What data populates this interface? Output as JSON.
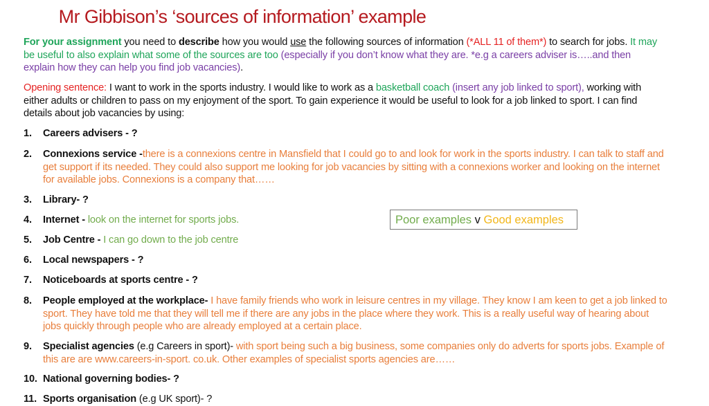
{
  "title": "Mr Gibbison’s ‘sources of information’ example",
  "intro": {
    "lead": "For your assignment",
    "t1": " you need to ",
    "describe": "describe",
    "t2": " how you would ",
    "use": "use",
    "t3": " the following sources of information ",
    "all11": "(*ALL 11 of them*)",
    "t4": " to search for jobs. ",
    "green_tip": "It may be useful to also explain what some of the sources are too",
    "purple_tip": " (especially if you don’t know what they are. *e.g a careers adviser is…..and then explain how they can help you find job vacancies)",
    "end": "."
  },
  "opening": {
    "label": "Opening sentence:",
    "t1": " I want to work in the sports industry.  I would like to work as a ",
    "job": "basketball coach",
    "hint": " (insert any job linked to sport),",
    "t2": " working with either adults or children to pass on my enjoyment of the sport.  To gain experience it would be useful to look for a job linked to sport.  I can find details about job vacancies by using:"
  },
  "legend_box": {
    "poor": "Poor examples",
    "vs": " v ",
    "good": "Good examples",
    "colors": {
      "poor": "#72ac4d",
      "good": "#f2b61a"
    }
  },
  "items": [
    {
      "num": "1.",
      "label": "Careers advisers - ?",
      "extra": "",
      "note": ""
    },
    {
      "num": "2.",
      "label": "Connexions service -",
      "extra": "",
      "note": "there is a connexions centre in Mansfield that I could go to and look for work in the sports industry. I can talk to staff and get support if its needed. They could also support me looking for job vacancies by sitting with a connexions worker and looking on the internet for available jobs. Connexions is a company that……"
    },
    {
      "num": "3.",
      "label": "Library- ?",
      "extra": "",
      "note": ""
    },
    {
      "num": "4.",
      "label": "Internet - ",
      "extra": "",
      "note": "look on the internet for sports jobs."
    },
    {
      "num": "5.",
      "label": "Job Centre - ",
      "extra": "",
      "note": "I can go down to the job centre"
    },
    {
      "num": "6.",
      "label": "Local newspapers - ?",
      "extra": "",
      "note": ""
    },
    {
      "num": "7.",
      "label": "Noticeboards at sports centre - ?",
      "extra": "",
      "note": ""
    },
    {
      "num": "8.",
      "label": "People employed at the workplace-",
      "extra": "",
      "note": " I have family friends who work in leisure centres in my village. They know I am keen to get a job linked to sport. They have told me that they will tell me if there are any jobs in the place where they work. This is a really useful way of hearing about jobs quickly through people who are already employed at a certain place."
    },
    {
      "num": "9.",
      "label": "Specialist agencies",
      "extra": " (e.g Careers in sport)- ",
      "note": "with sport being such a big business, some companies only do adverts for sports jobs. Example of this are are www.careers-in-sport. co.uk. Other examples of specialist sports agencies are……"
    },
    {
      "num": "10.",
      "label": "National governing bodies- ?",
      "extra": "",
      "note": ""
    },
    {
      "num": "11.",
      "label": "Sports organisation",
      "extra": " (e.g UK sport)- ?",
      "note": ""
    }
  ]
}
